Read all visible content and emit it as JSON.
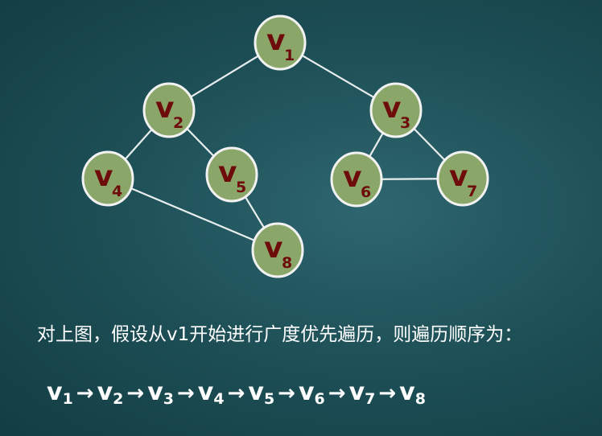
{
  "graph": {
    "nodes": [
      {
        "id": "v1",
        "letter": "v",
        "sub": "1"
      },
      {
        "id": "v2",
        "letter": "v",
        "sub": "2"
      },
      {
        "id": "v3",
        "letter": "v",
        "sub": "3"
      },
      {
        "id": "v4",
        "letter": "v",
        "sub": "4"
      },
      {
        "id": "v5",
        "letter": "v",
        "sub": "5"
      },
      {
        "id": "v6",
        "letter": "v",
        "sub": "6"
      },
      {
        "id": "v7",
        "letter": "v",
        "sub": "7"
      },
      {
        "id": "v8",
        "letter": "v",
        "sub": "8"
      }
    ],
    "edges": [
      [
        "v1",
        "v2"
      ],
      [
        "v1",
        "v3"
      ],
      [
        "v2",
        "v4"
      ],
      [
        "v2",
        "v5"
      ],
      [
        "v3",
        "v6"
      ],
      [
        "v3",
        "v7"
      ],
      [
        "v6",
        "v7"
      ],
      [
        "v4",
        "v8"
      ],
      [
        "v5",
        "v8"
      ]
    ]
  },
  "caption": "对上图，假设从v1开始进行广度优先遍历，则遍历顺序为：",
  "traversal": {
    "arrow": "→",
    "order": [
      {
        "letter": "v",
        "sub": "1"
      },
      {
        "letter": "v",
        "sub": "2"
      },
      {
        "letter": "v",
        "sub": "3"
      },
      {
        "letter": "v",
        "sub": "4"
      },
      {
        "letter": "v",
        "sub": "5"
      },
      {
        "letter": "v",
        "sub": "6"
      },
      {
        "letter": "v",
        "sub": "7"
      },
      {
        "letter": "v",
        "sub": "8"
      }
    ]
  },
  "colors": {
    "node_fill": "#8aa769",
    "node_stroke": "#f2f2f2",
    "node_text": "#6e0c0c",
    "edge": "#e8eeee",
    "background": "#1f5158",
    "text": "#ffffff"
  }
}
